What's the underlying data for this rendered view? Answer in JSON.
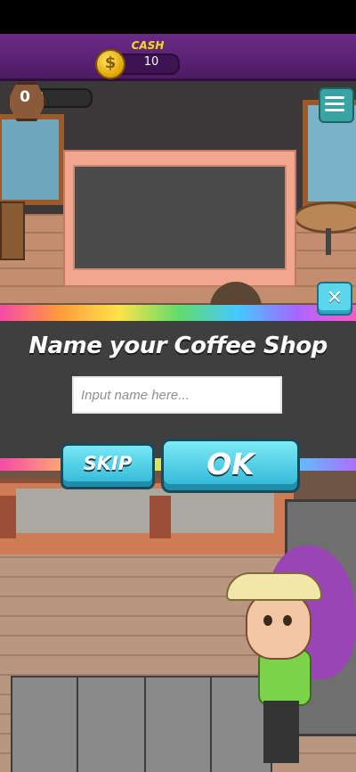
{
  "hud": {
    "cash_label": "CASH",
    "cash_value": "10",
    "currency_icon": "dollar-coin-icon",
    "level": "0",
    "xp_progress": 0.08,
    "menu_icon": "hamburger-menu-icon"
  },
  "dialog": {
    "title": "Name your Coffee Shop",
    "input_placeholder": "Input name here...",
    "input_value": "",
    "skip_label": "SKIP",
    "ok_label": "OK",
    "close_icon": "close-x-icon"
  },
  "colors": {
    "header_purple": "#5a1f74",
    "button_cyan": "#3fc4de",
    "cash_gold": "#f6d23a",
    "dialog_gray": "#3f3f3f"
  }
}
